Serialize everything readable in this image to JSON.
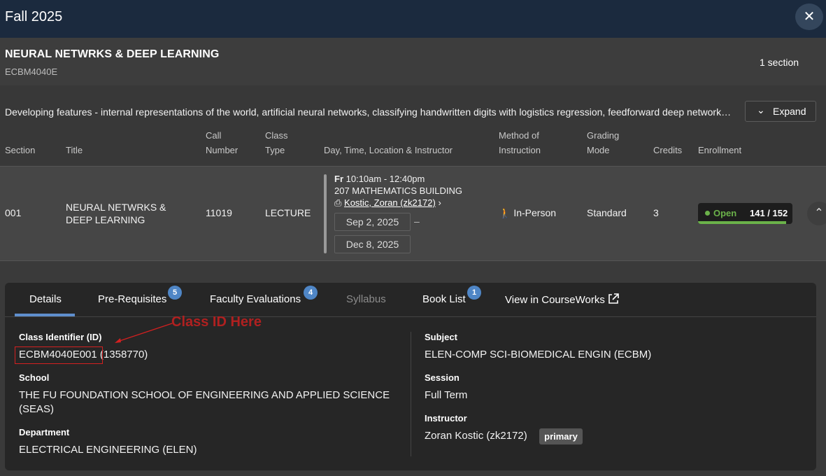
{
  "window": {
    "title": "Fall 2025",
    "close_icon": "close-icon"
  },
  "course": {
    "title": "NEURAL NETWRKS & DEEP LEARNING",
    "code": "ECBM4040E",
    "section_count": "1 section",
    "description": "Developing features - internal representations of the world, artificial neural networks, classifying handwritten digits with logistics regression, feedforward deep networks, back propagation in multilayer perceptrons, regularization of deep or distributed models, optimization for training deep models, convolutional neural networks",
    "expand_label": "Expand"
  },
  "table": {
    "headers": {
      "section": "Section",
      "title": "Title",
      "call_number": [
        "Call",
        "Number"
      ],
      "class_type": [
        "Class",
        "Type"
      ],
      "dtli": "Day, Time, Location & Instructor",
      "method": [
        "Method of",
        "Instruction"
      ],
      "grading": [
        "Grading",
        "Mode"
      ],
      "credits": "Credits",
      "enrollment": "Enrollment"
    },
    "row": {
      "section": "001",
      "title": "NEURAL NETWRKS & DEEP LEARNING",
      "call_number": "11019",
      "class_type": "LECTURE",
      "day": "Fr",
      "time": "10:10am - 12:40pm",
      "location": "207 MATHEMATICS BUILDING",
      "instructor": "Kostic, Zoran (zk2172)",
      "start_date": "Sep 2, 2025",
      "date_sep": "–",
      "end_date": "Dec 8, 2025",
      "method": "In-Person",
      "grading": "Standard",
      "credits": "3",
      "enrollment_status": "Open",
      "enrollment_count": "141 / 152",
      "enrollment_fraction": 0.93
    }
  },
  "tabs": [
    {
      "label": "Details",
      "active": true
    },
    {
      "label": "Pre-Requisites",
      "badge": "5"
    },
    {
      "label": "Faculty Evaluations",
      "badge": "4"
    },
    {
      "label": "Syllabus",
      "disabled": true
    },
    {
      "label": "Book List",
      "badge": "1"
    },
    {
      "label": "View in CourseWorks",
      "icon": "external-link-icon"
    }
  ],
  "details": {
    "class_id_label": "Class Identifier (ID)",
    "class_id": "ECBM4040E001",
    "class_id_num": " (1358770)",
    "school_label": "School",
    "school_line1": "THE FU FOUNDATION SCHOOL OF ENGINEERING AND APPLIED SCIENCE",
    "school_line2": "(SEAS)",
    "department_label": "Department",
    "department": "ELECTRICAL ENGINEERING (ELEN)",
    "subject_label": "Subject",
    "subject": "ELEN-COMP SCI-BIOMEDICAL ENGIN (ECBM)",
    "session_label": "Session",
    "session": "Full Term",
    "instructor_label": "Instructor",
    "instructor": "Zoran Kostic (zk2172)",
    "instructor_role": "primary"
  },
  "annotation": {
    "text": "Class ID Here",
    "color": "#d42020"
  },
  "colors": {
    "topbar": "#1b2a3e",
    "accent": "#4f86c6",
    "open": "#6bb24a"
  }
}
